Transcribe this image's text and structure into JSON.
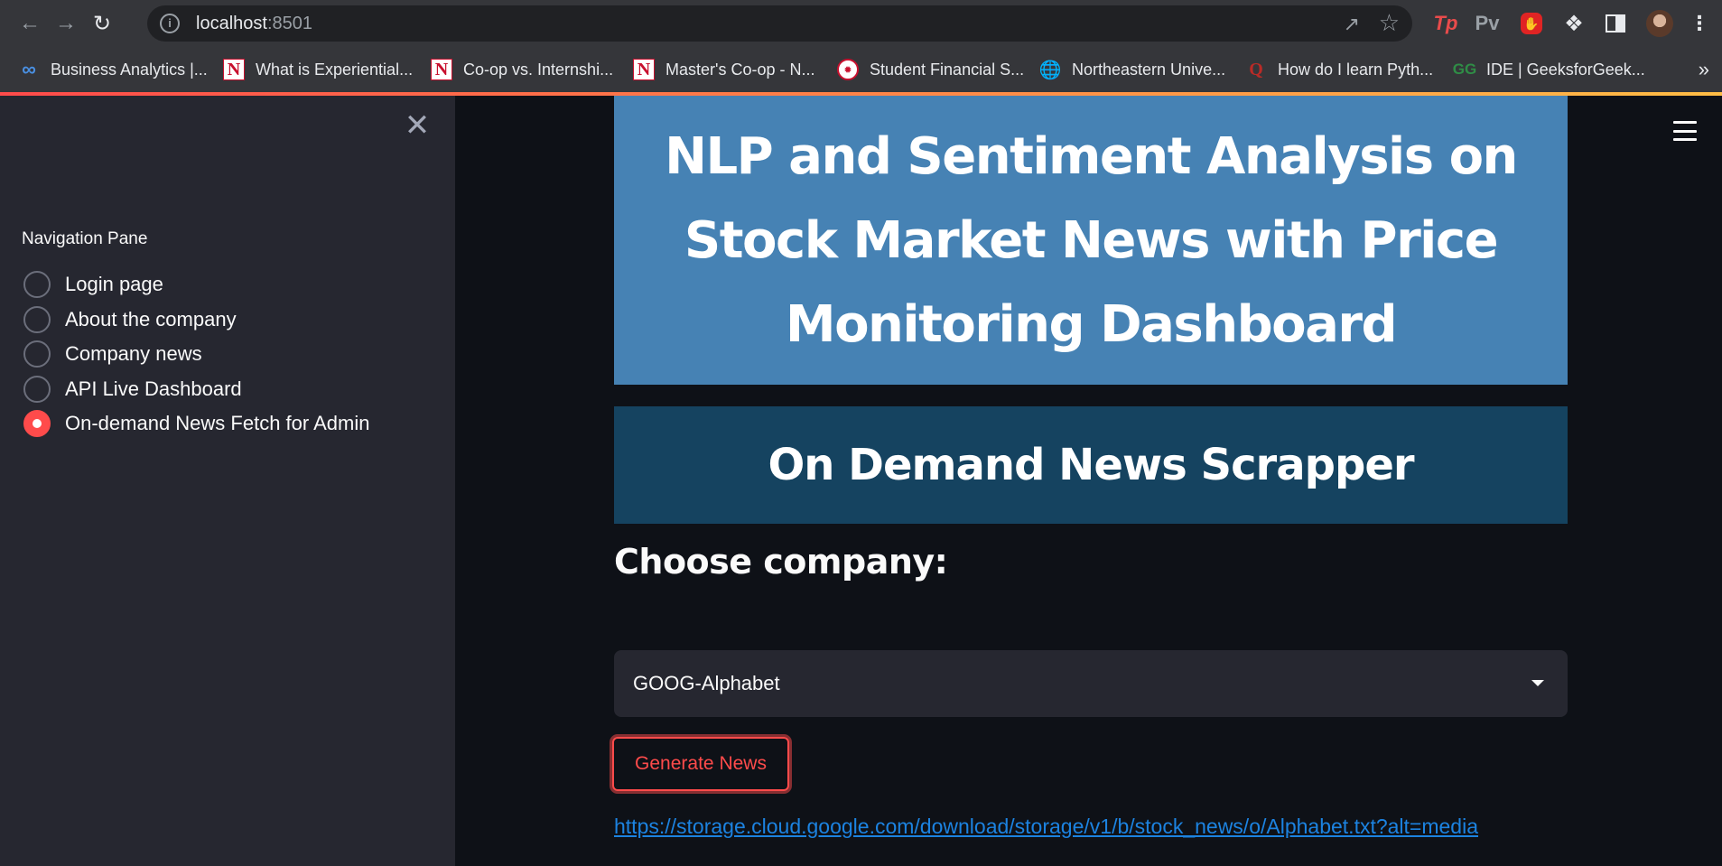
{
  "browser": {
    "url_host": "localhost",
    "url_port": ":8501",
    "bookmarks": [
      {
        "label": "Business Analytics |...",
        "icon": "infinity-icon"
      },
      {
        "label": "What is Experiential...",
        "icon": "n-logo-icon"
      },
      {
        "label": "Co-op vs. Internshi...",
        "icon": "n-logo-icon"
      },
      {
        "label": "Master's Co-op - N...",
        "icon": "n-logo-icon"
      },
      {
        "label": "Student Financial S...",
        "icon": "seal-icon"
      },
      {
        "label": "Northeastern Unive...",
        "icon": "globe-icon"
      },
      {
        "label": "How do I learn Pyth...",
        "icon": "quora-icon"
      },
      {
        "label": "IDE | GeeksforGeek...",
        "icon": "gfg-icon"
      }
    ],
    "extensions": {
      "tp": "Tp",
      "pv": "Pv"
    }
  },
  "sidebar": {
    "title": "Navigation Pane",
    "options": [
      {
        "label": "Login page",
        "checked": false
      },
      {
        "label": "About the company",
        "checked": false
      },
      {
        "label": "Company news",
        "checked": false
      },
      {
        "label": "API Live Dashboard",
        "checked": false
      },
      {
        "label": "On-demand News Fetch for Admin",
        "checked": true
      }
    ]
  },
  "main": {
    "title": "NLP and Sentiment Analysis on Stock Market News with Price Monitoring Dashboard",
    "subtitle": "On Demand News Scrapper",
    "choose_label": "Choose company:",
    "company_selected": "GOOG-Alphabet",
    "generate_button": "Generate News",
    "result_link": "https://storage.cloud.google.com/download/storage/v1/b/stock_news/o/Alphabet.txt?alt=media"
  },
  "colors": {
    "title_bg": "#4682b4",
    "subtitle_bg": "#154360",
    "accent": "#ff4b4b",
    "link": "#1c83e1",
    "app_bg": "#0e1117",
    "sidebar_bg": "#262730"
  }
}
